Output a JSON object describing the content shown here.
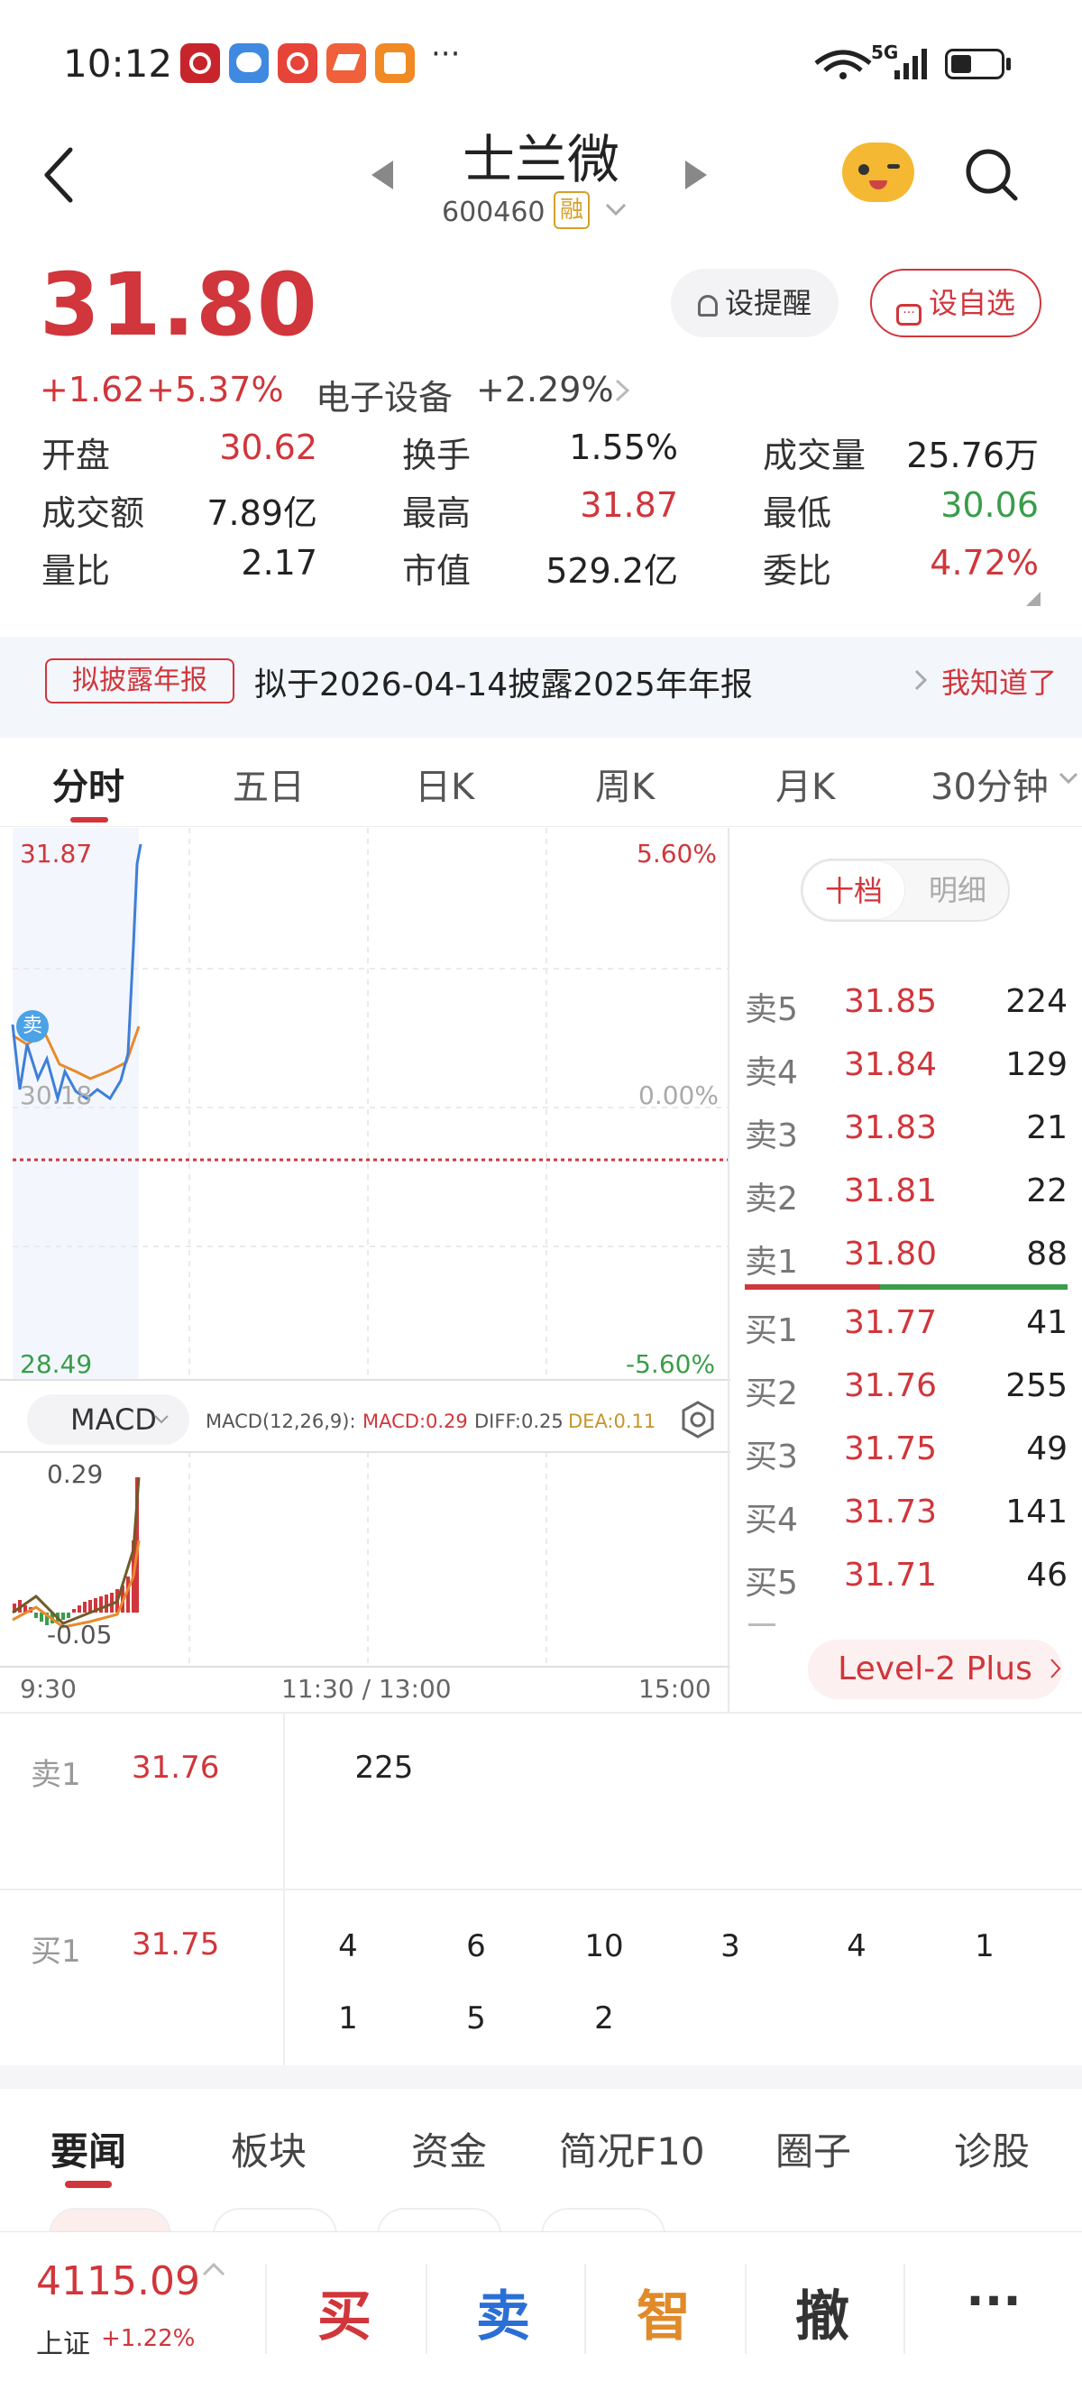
{
  "status_bar": {
    "time": "10:12",
    "more": "···",
    "signal": "5G"
  },
  "header": {
    "title": "士兰微",
    "code": "600460",
    "margin_tag": "融"
  },
  "quote": {
    "price": "31.80",
    "change": "+1.62",
    "change_pct": "+5.37%",
    "sector": "电子设备",
    "sector_pct": "+2.29%",
    "alert_label": "设提醒",
    "fav_label": "设自选",
    "stats": [
      [
        {
          "label": "开盘",
          "value": "30.62",
          "color": "red"
        },
        {
          "label": "换手",
          "value": "1.55%",
          "color": "dark"
        },
        {
          "label": "成交量",
          "value": "25.76万",
          "color": "dark"
        }
      ],
      [
        {
          "label": "成交额",
          "value": "7.89亿",
          "color": "dark"
        },
        {
          "label": "最高",
          "value": "31.87",
          "color": "red"
        },
        {
          "label": "最低",
          "value": "30.06",
          "color": "green"
        }
      ],
      [
        {
          "label": "量比",
          "value": "2.17",
          "color": "dark"
        },
        {
          "label": "市值",
          "value": "529.2亿",
          "color": "dark"
        },
        {
          "label": "委比",
          "value": "4.72%",
          "color": "red"
        }
      ]
    ]
  },
  "notice": {
    "tag": "拟披露年报",
    "text": "拟于2026-04-14披露2025年年报",
    "action": "我知道了"
  },
  "tabs": [
    "分时",
    "五日",
    "日K",
    "周K",
    "月K",
    "30分钟"
  ],
  "chart": {
    "price_high": "31.87",
    "pct_high": "5.60%",
    "price_mid": "30.18",
    "pct_mid": "0.00%",
    "price_low": "28.49",
    "pct_low": "-5.60%",
    "sell_marker": "卖",
    "macd_select": "MACD",
    "macd_params": "MACD(12,26,9):",
    "macd_val": "MACD:0.29",
    "diff_val": "DIFF:0.25",
    "dea_val": "DEA:0.11",
    "macd_top": "0.29",
    "macd_bottom": "-0.05",
    "time_start": "9:30",
    "time_mid": "11:30 / 13:00",
    "time_end": "15:00",
    "colors": {
      "price_line": "#3f7fd8",
      "avg_line": "#e88a2c",
      "up": "#d0363b",
      "down": "#3a9d4a"
    }
  },
  "orderbook": {
    "seg_a": "十档",
    "seg_b": "明细",
    "asks": [
      {
        "label": "卖5",
        "price": "31.85",
        "vol": "224"
      },
      {
        "label": "卖4",
        "price": "31.84",
        "vol": "129"
      },
      {
        "label": "卖3",
        "price": "31.83",
        "vol": "21"
      },
      {
        "label": "卖2",
        "price": "31.81",
        "vol": "22"
      },
      {
        "label": "卖1",
        "price": "31.80",
        "vol": "88"
      }
    ],
    "bids": [
      {
        "label": "买1",
        "price": "31.77",
        "vol": "41"
      },
      {
        "label": "买2",
        "price": "31.76",
        "vol": "255"
      },
      {
        "label": "买3",
        "price": "31.75",
        "vol": "49"
      },
      {
        "label": "买4",
        "price": "31.73",
        "vol": "141"
      },
      {
        "label": "买5",
        "price": "31.71",
        "vol": "46"
      }
    ],
    "level2": "Level-2 Plus"
  },
  "queue": {
    "sell": {
      "label": "卖1",
      "price": "31.76",
      "orders": [
        "225"
      ]
    },
    "buy": {
      "label": "买1",
      "price": "31.75",
      "orders": [
        "4",
        "6",
        "10",
        "3",
        "4",
        "1",
        "1",
        "5",
        "2"
      ]
    }
  },
  "news_tabs": [
    "要闻",
    "板块",
    "资金",
    "简况F10",
    "圈子",
    "诊股"
  ],
  "bottom": {
    "index_value": "4115.09",
    "index_name": "上证",
    "index_chg": "+1.22%",
    "buy": "买",
    "sell": "卖",
    "smart": "智",
    "cancel": "撤",
    "more": "···"
  }
}
